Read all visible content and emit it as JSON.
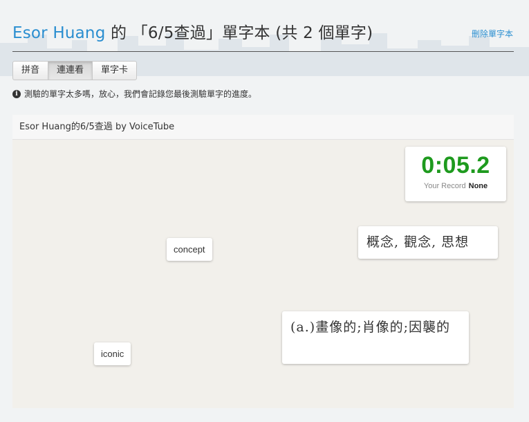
{
  "header": {
    "owner": "Esor Huang",
    "title_rest": " 的 「6/5查過」單字本 (共 2 個單字)",
    "delete_label": "刪除單字本"
  },
  "tabs": [
    {
      "label": "拼音",
      "active": false
    },
    {
      "label": "連連看",
      "active": true
    },
    {
      "label": "單字卡",
      "active": false
    }
  ],
  "notice": {
    "icon": "info-icon",
    "text": "測驗的單字太多嗎，放心，我們會記錄您最後測驗單字的進度。"
  },
  "panel": {
    "title": "Esor Huang的6/5查過 by VoiceTube"
  },
  "timer": {
    "value": "0:05.2",
    "record_label": "Your Record",
    "record_value": "None"
  },
  "cards": {
    "word_1": "concept",
    "word_2": "iconic",
    "def_1": "概念, 觀念, 思想",
    "def_2": "(a.)畫像的;肖像的;因襲的"
  },
  "colors": {
    "accent": "#2a8ed0",
    "timer": "#1e9a1e",
    "board": "#f2f0eb"
  }
}
